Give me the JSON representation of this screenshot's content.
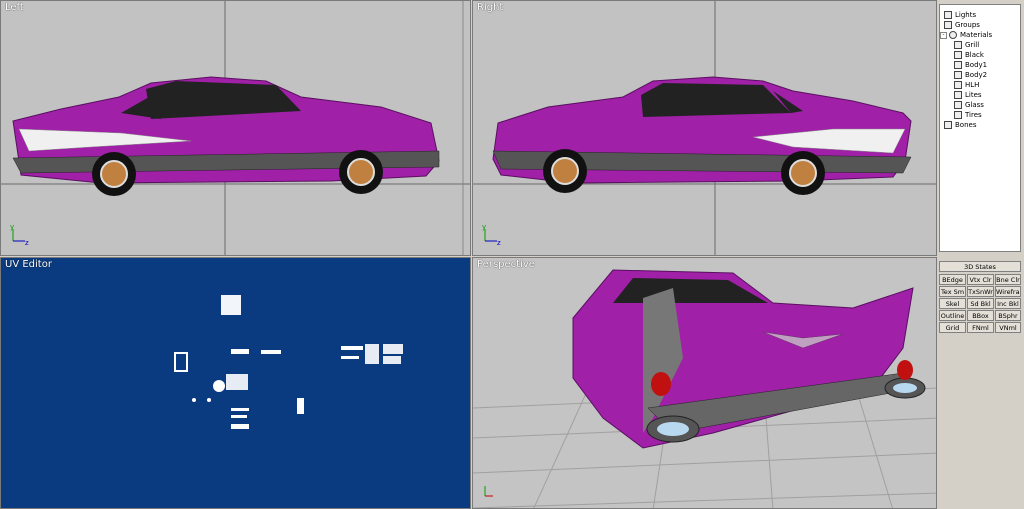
{
  "viewports": {
    "left": {
      "label": "Left",
      "axis_y": "y",
      "axis_z": "z"
    },
    "right": {
      "label": "Right",
      "axis_y": "y",
      "axis_z": "z"
    },
    "uv": {
      "label": "UV Editor"
    },
    "perspective": {
      "label": "Perspective"
    }
  },
  "tree": {
    "items": [
      {
        "label": "Lights",
        "icon": "light-icon",
        "level": 0
      },
      {
        "label": "Groups",
        "icon": "groups-icon",
        "level": 0
      },
      {
        "label": "Materials",
        "icon": "materials-icon",
        "level": 0,
        "expanded": true
      },
      {
        "label": "Grill",
        "icon": "material-icon",
        "level": 1
      },
      {
        "label": "Black",
        "icon": "material-icon",
        "level": 1
      },
      {
        "label": "Body1",
        "icon": "material-icon",
        "level": 1
      },
      {
        "label": "Body2",
        "icon": "material-icon",
        "level": 1
      },
      {
        "label": "HLH",
        "icon": "material-icon",
        "level": 1
      },
      {
        "label": "Lites",
        "icon": "material-icon",
        "level": 1
      },
      {
        "label": "Glass",
        "icon": "material-icon",
        "level": 1
      },
      {
        "label": "Tires",
        "icon": "material-icon",
        "level": 1
      },
      {
        "label": "Bones",
        "icon": "bones-icon",
        "level": 0
      }
    ]
  },
  "states_panel": {
    "title": "3D States",
    "buttons": [
      [
        "BEdge",
        "Vtx Clr",
        "Bne Clr"
      ],
      [
        "Tex Sm",
        "TxSnWr",
        "Wireframe"
      ],
      [
        "Skel",
        "Sd Bkl",
        "Inc Bkl"
      ],
      [
        "Outline",
        "BBox",
        "BSphr"
      ],
      [
        "Grid",
        "FNml",
        "VNml"
      ]
    ]
  },
  "colors": {
    "body": "#a020a8",
    "viewport_bg": "#c2c2c2",
    "uv_bg": "#0a3a80",
    "panel_bg": "#d4d0c8"
  }
}
